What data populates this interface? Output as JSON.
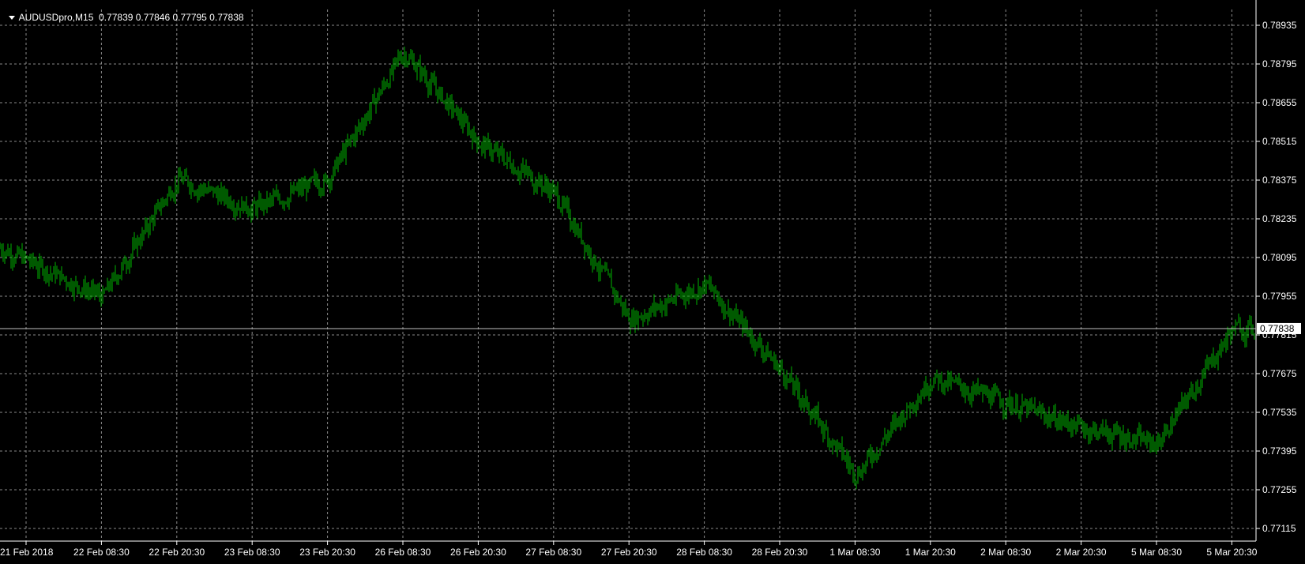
{
  "header": {
    "symbol": "AUDUSDpro,M15",
    "ohlc": "0.77839 0.77846 0.77795 0.77838"
  },
  "colors": {
    "background": "#000000",
    "bars": "#00b400",
    "grid": "#8a8a8a",
    "text": "#ffffff",
    "bid_line": "#c0c0c0"
  },
  "chart_data": {
    "type": "line",
    "instrument": "AUDUSDpro",
    "timeframe": "M15",
    "grid": true,
    "grid_style": "dashed",
    "ylim": [
      0.7708,
      0.7899
    ],
    "y_tick_labels": [
      "0.78935",
      "0.78795",
      "0.78655",
      "0.78515",
      "0.78375",
      "0.78235",
      "0.78095",
      "0.77955",
      "0.77815",
      "0.77675",
      "0.77535",
      "0.77395",
      "0.77255",
      "0.77115"
    ],
    "x_tick_labels": [
      "21 Feb 2018",
      "22 Feb 08:30",
      "22 Feb 20:30",
      "23 Feb 08:30",
      "23 Feb 20:30",
      "26 Feb 08:30",
      "26 Feb 20:30",
      "27 Feb 08:30",
      "27 Feb 20:30",
      "28 Feb 08:30",
      "28 Feb 20:30",
      "1 Mar 08:30",
      "1 Mar 20:30",
      "2 Mar 08:30",
      "2 Mar 20:30",
      "5 Mar 08:30",
      "5 Mar 20:30"
    ],
    "current_price": "0.77838",
    "series": [
      {
        "x": [
          "21 Feb 2018",
          "22 Feb 08:30",
          "22 Feb 20:30",
          "23 Feb 08:30",
          "23 Feb 20:30",
          "26 Feb 08:30",
          "26 Feb 20:30",
          "27 Feb 08:30",
          "27 Feb 20:30",
          "28 Feb 08:30",
          "28 Feb 20:30",
          "1 Mar 08:30",
          "1 Mar 20:30",
          "2 Mar 08:30",
          "2 Mar 20:30",
          "5 Mar 08:30",
          "5 Mar 20:30"
        ],
        "values": [
          0.7813,
          0.7795,
          0.7838,
          0.7827,
          0.7838,
          0.7884,
          0.7851,
          0.7833,
          0.7787,
          0.78,
          0.7769,
          0.7731,
          0.7766,
          0.7757,
          0.7748,
          0.7742,
          0.77838
        ]
      }
    ]
  }
}
